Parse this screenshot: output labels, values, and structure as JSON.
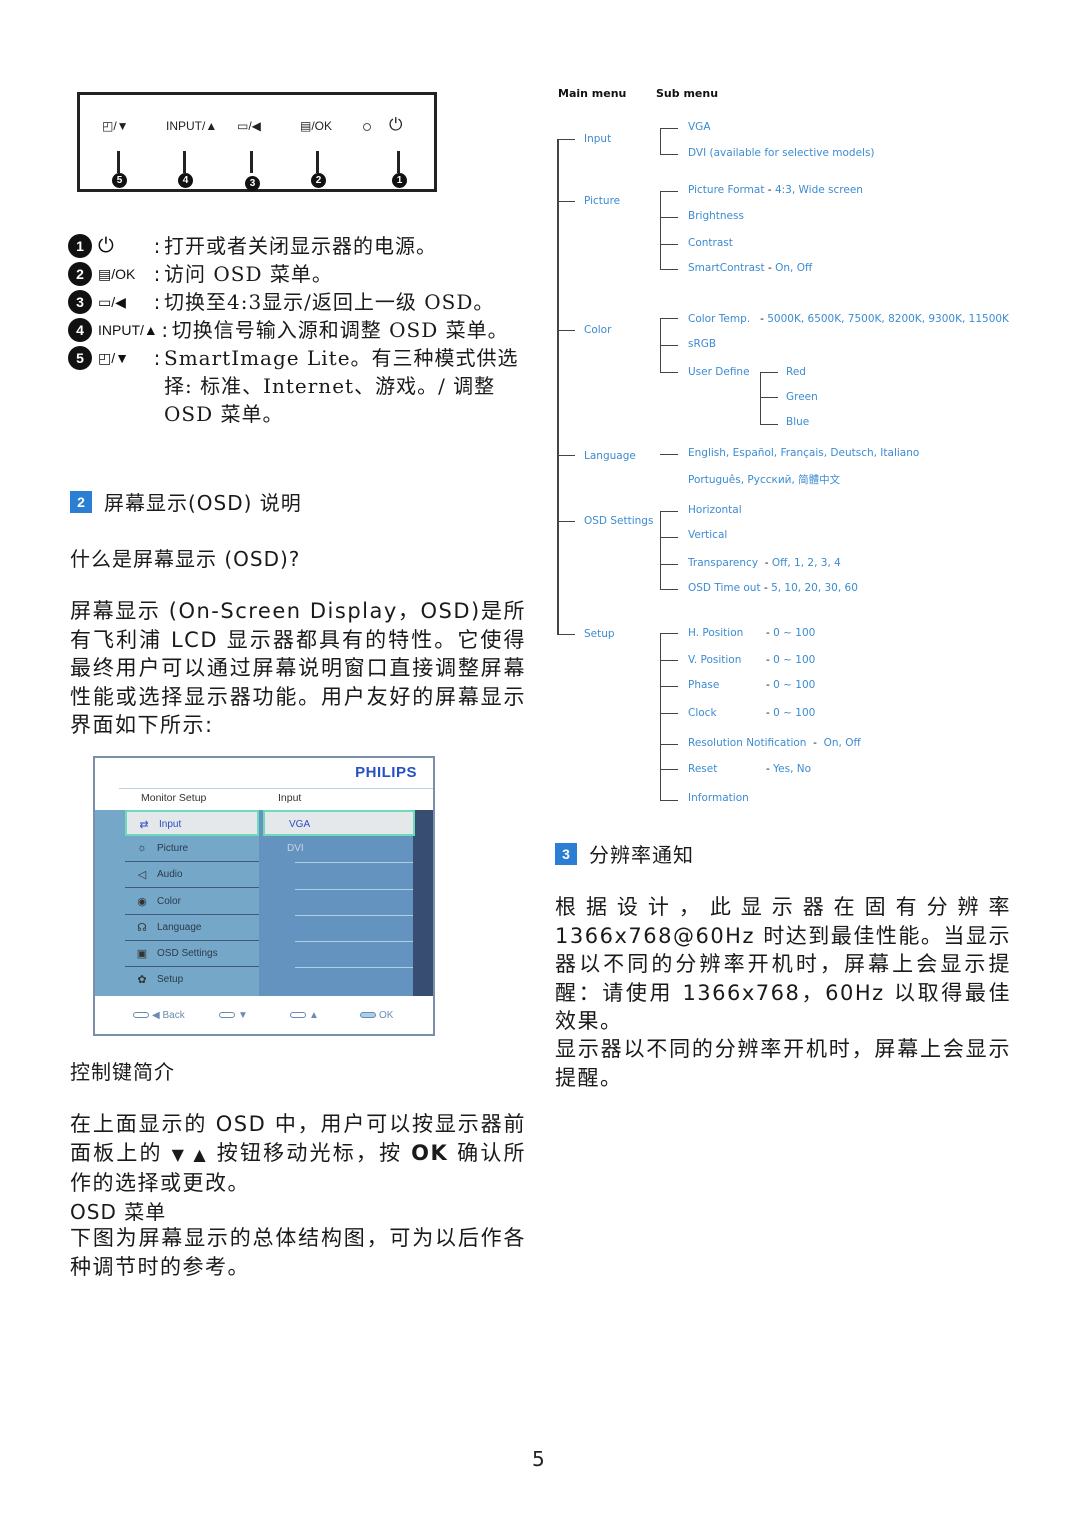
{
  "control_panel": {
    "buttons": [
      {
        "num": "5",
        "label": "◰/▼",
        "icon": "smartimage-icon"
      },
      {
        "num": "4",
        "label": "INPUT/▲",
        "icon": "input-icon"
      },
      {
        "num": "3",
        "label": "▭/◀",
        "icon": "aspect-ratio-icon"
      },
      {
        "num": "2",
        "label": "▤/OK",
        "icon": "menu-icon"
      },
      {
        "num": "1",
        "label": "⏻",
        "icon": "power-icon"
      }
    ]
  },
  "key_legend": [
    {
      "num": "1",
      "key": "⏻",
      "text": "打开或者关闭显示器的电源。"
    },
    {
      "num": "2",
      "key": "▤/OK",
      "text": "访问 OSD 菜单。"
    },
    {
      "num": "3",
      "key": "▭/◀",
      "text": "切换至4:3显示/返回上一级 OSD。"
    },
    {
      "num": "4",
      "key": "INPUT/▲",
      "text": "切换信号输入源和调整 OSD 菜单。"
    },
    {
      "num": "5",
      "key": "◰/▼",
      "text": "SmartImage Lite。有三种模式供选择: 标准、Internet、游戏。/ 调整 OSD 菜单。"
    }
  ],
  "section2": {
    "badge": "2",
    "title": "屏幕显示(OSD) 说明",
    "q_title": "什么是屏幕显示 (OSD)?",
    "intro": "屏幕显示 (On-Screen Display，OSD)是所有飞利浦 LCD 显示器都具有的特性。它使得最终用户可以通过屏幕说明窗口直接调整屏幕性能或选择显示器功能。用户友好的屏幕显示界面如下所示:",
    "controls_title": "控制键简介",
    "controls_text_1": "在上面显示的 OSD 中，用户可以按显示器前面板上的",
    "controls_arrows": "▼ ▲",
    "controls_text_2": "按钮移动光标，按",
    "controls_ok": "OK",
    "controls_text_3": "确认所作的选择或更改。",
    "osd_menu_title": "OSD 菜单",
    "osd_menu_text": "下图为屏幕显示的总体结构图，可为以后作各种调节时的参考。"
  },
  "osd_screen": {
    "brand": "PHILIPS",
    "header_left": "Monitor Setup",
    "header_right": "Input",
    "menu_items": [
      {
        "label": "Input",
        "icon": "⇄",
        "selected": true
      },
      {
        "label": "Picture",
        "icon": "☼",
        "selected": false
      },
      {
        "label": "Audio",
        "icon": "◁",
        "selected": false
      },
      {
        "label": "Color",
        "icon": "◉",
        "selected": false
      },
      {
        "label": "Language",
        "icon": "☊",
        "selected": false
      },
      {
        "label": "OSD Settings",
        "icon": "▣",
        "selected": false
      },
      {
        "label": "Setup",
        "icon": "✿",
        "selected": false
      }
    ],
    "sub_items": [
      {
        "label": "VGA",
        "selected": true
      },
      {
        "label": "DVI",
        "selected": false
      }
    ],
    "footer": {
      "back": "◀ Back",
      "down": "▼",
      "up": "▲",
      "ok": "OK"
    }
  },
  "menu_tree": {
    "header_main": "Main menu",
    "header_sub": "Sub menu",
    "input": {
      "label": "Input",
      "items": [
        "VGA",
        "DVI (available for selective models)"
      ]
    },
    "picture": {
      "label": "Picture",
      "items": [
        {
          "label": "Picture Format",
          "value": "4:3, Wide screen"
        },
        {
          "label": "Brightness",
          "value": ""
        },
        {
          "label": "Contrast",
          "value": ""
        },
        {
          "label": "SmartContrast",
          "value": "On, Off"
        }
      ]
    },
    "color": {
      "label": "Color",
      "items": [
        {
          "label": "Color Temp.",
          "value": "5000K, 6500K, 7500K, 8200K, 9300K, 11500K"
        },
        {
          "label": "sRGB",
          "value": ""
        },
        {
          "label": "User Define",
          "value": ""
        }
      ],
      "user_define": [
        "Red",
        "Green",
        "Blue"
      ]
    },
    "language": {
      "label": "Language",
      "line1": "English, Español, Français, Deutsch, Italiano",
      "line2": "Português, Русский, 简體中文"
    },
    "osd_settings": {
      "label": "OSD Settings",
      "items": [
        {
          "label": "Horizontal",
          "value": ""
        },
        {
          "label": "Vertical",
          "value": ""
        },
        {
          "label": "Transparency",
          "value": "Off, 1, 2, 3, 4"
        },
        {
          "label": "OSD Time out",
          "value": "5, 10, 20, 30, 60"
        }
      ]
    },
    "setup": {
      "label": "Setup",
      "items": [
        {
          "label": "H. Position",
          "value": "0 ~ 100"
        },
        {
          "label": "V. Position",
          "value": "0 ~ 100"
        },
        {
          "label": "Phase",
          "value": "0 ~ 100"
        },
        {
          "label": "Clock",
          "value": "0 ~ 100"
        },
        {
          "label": "Resolution Notification",
          "value": "On, Off"
        },
        {
          "label": "Reset",
          "value": "Yes, No"
        },
        {
          "label": "Information",
          "value": ""
        }
      ]
    }
  },
  "section3": {
    "badge": "3",
    "title": "分辨率通知",
    "para1": "根据设计，此显示器在固有分辨率1366x768@60Hz 时达到最佳性能。当显示器以不同的分辨率开机时，屏幕上会显示提醒：请使用 1366x768，60Hz 以取得最佳效果。",
    "para2": "显示器以不同的分辨率开机时，屏幕上会显示提醒。"
  },
  "page_number": "5"
}
